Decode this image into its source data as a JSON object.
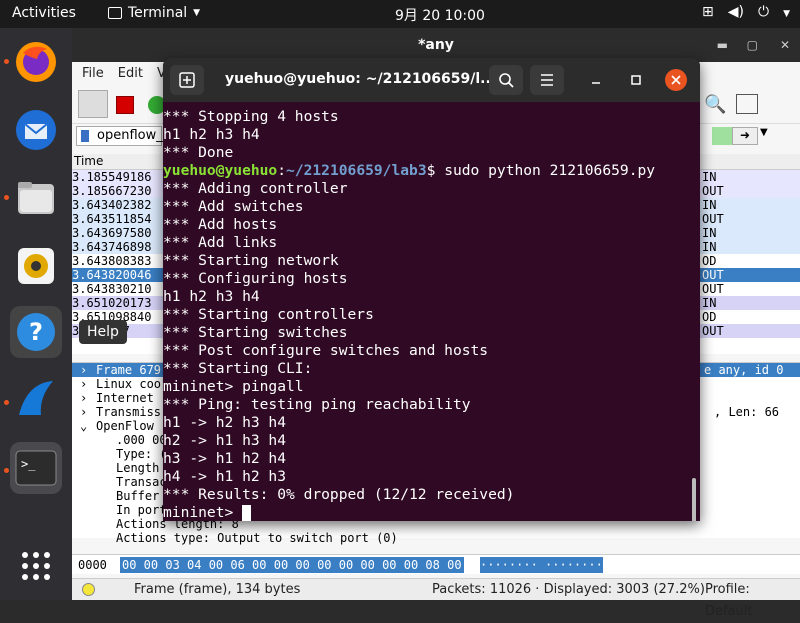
{
  "topbar": {
    "activities": "Activities",
    "app_name": "Terminal",
    "clock": "9月 20  10:00"
  },
  "dock": {
    "help_tooltip": "Help"
  },
  "wireshark": {
    "title": "*any",
    "menu": [
      "File",
      "Edit",
      "V"
    ],
    "filter_text": "openflow_v",
    "column_time": "Time",
    "packets": [
      {
        "time": "3.185549186",
        "dir": "IN",
        "bg": "#e7e6ff"
      },
      {
        "time": "3.185667230",
        "dir": "OUT",
        "bg": "#e7e6ff"
      },
      {
        "time": "3.643402382",
        "dir": "IN",
        "bg": "#dae9fb"
      },
      {
        "time": "3.643511854",
        "dir": "OUT",
        "bg": "#dae9fb"
      },
      {
        "time": "3.643697580",
        "dir": "IN",
        "bg": "#dae9fb"
      },
      {
        "time": "3.643746898",
        "dir": "IN",
        "bg": "#dae9fb"
      },
      {
        "time": "3.643808383",
        "dir": "OD",
        "bg": "#ffffff"
      },
      {
        "time": "3.643820046",
        "dir": "OUT",
        "bg": "#3a7fc4"
      },
      {
        "time": "3.643830210",
        "dir": "OUT",
        "bg": "#ffffff"
      },
      {
        "time": "3.651020173",
        "dir": "IN",
        "bg": "#d6d3f7"
      },
      {
        "time": "3.651098840",
        "dir": "OD",
        "bg": "#ffffff"
      },
      {
        "time": "3.65  237",
        "dir": "OUT",
        "bg": "#d6d3f7"
      }
    ],
    "detail_lines": [
      {
        "text": "Frame 679",
        "indent": 0,
        "arrow": ">",
        "right": "e any, id 0",
        "selected": true
      },
      {
        "text": "Linux coo",
        "indent": 0,
        "arrow": ">",
        "right": ""
      },
      {
        "text": "Internet",
        "indent": 0,
        "arrow": ">",
        "right": ""
      },
      {
        "text": "Transmiss",
        "indent": 0,
        "arrow": ">",
        "right": ", Len: 66"
      },
      {
        "text": "OpenFlow",
        "indent": 0,
        "arrow": "v",
        "right": ""
      },
      {
        "text": ".000 00",
        "indent": 1,
        "arrow": "",
        "right": ""
      },
      {
        "text": "Type: (",
        "indent": 1,
        "arrow": "",
        "right": ""
      },
      {
        "text": "Length",
        "indent": 1,
        "arrow": "",
        "right": ""
      },
      {
        "text": "Transac",
        "indent": 1,
        "arrow": "",
        "right": ""
      },
      {
        "text": "Buffer",
        "indent": 1,
        "arrow": "",
        "right": ""
      },
      {
        "text": "In port",
        "indent": 1,
        "arrow": "",
        "right": ""
      },
      {
        "text": "Actions length: 8",
        "indent": 1,
        "arrow": "",
        "right": ""
      },
      {
        "text": "Actions type: Output to switch port (0)",
        "indent": 1,
        "arrow": "",
        "right": ""
      }
    ],
    "bytes_offset": "0000",
    "bytes_hex": "00 00 03 04 00 06 00 00  00 00 00 00 00 00 08 00",
    "bytes_ascii": "········ ········",
    "status_frame": "Frame (frame), 134 bytes",
    "status_packets": "Packets: 11026 · Displayed: 3003 (27.2%)",
    "status_profile": "Profile: Default"
  },
  "terminal": {
    "title": "yuehuo@yuehuo: ~/212106659/l...",
    "lines": [
      {
        "kind": "text",
        "text": "*** Stopping 4 hosts"
      },
      {
        "kind": "text",
        "text": "h1 h2 h3 h4"
      },
      {
        "kind": "text",
        "text": "*** Done"
      },
      {
        "kind": "prompt",
        "user": "yuehuo@yuehuo",
        "sep": ":",
        "path": "~/212106659/lab3",
        "cmd": "$ sudo python 212106659.py"
      },
      {
        "kind": "text",
        "text": "*** Adding controller"
      },
      {
        "kind": "text",
        "text": "*** Add switches"
      },
      {
        "kind": "text",
        "text": "*** Add hosts"
      },
      {
        "kind": "text",
        "text": "*** Add links"
      },
      {
        "kind": "text",
        "text": "*** Starting network"
      },
      {
        "kind": "text",
        "text": "*** Configuring hosts"
      },
      {
        "kind": "text",
        "text": "h1 h2 h3 h4"
      },
      {
        "kind": "text",
        "text": "*** Starting controllers"
      },
      {
        "kind": "text",
        "text": "*** Starting switches"
      },
      {
        "kind": "text",
        "text": "*** Post configure switches and hosts"
      },
      {
        "kind": "text",
        "text": "*** Starting CLI:"
      },
      {
        "kind": "text",
        "text": "mininet> pingall"
      },
      {
        "kind": "text",
        "text": "*** Ping: testing ping reachability"
      },
      {
        "kind": "text",
        "text": "h1 -> h2 h3 h4"
      },
      {
        "kind": "text",
        "text": "h2 -> h1 h3 h4"
      },
      {
        "kind": "text",
        "text": "h3 -> h1 h2 h4"
      },
      {
        "kind": "text",
        "text": "h4 -> h1 h2 h3"
      },
      {
        "kind": "text",
        "text": "*** Results: 0% dropped (12/12 received)"
      },
      {
        "kind": "cursor",
        "text": "mininet> "
      }
    ]
  },
  "colors": {
    "terminal_bg": "#300a24",
    "prompt_user": "#8ae234",
    "prompt_path": "#729fcf",
    "close_button": "#e95420"
  }
}
